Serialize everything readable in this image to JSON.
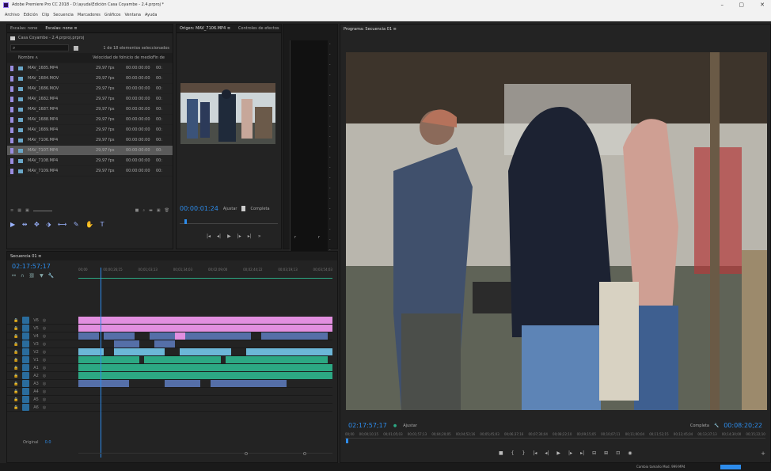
{
  "app": {
    "title": "Adobe Premiere Pro CC 2018 - D:\\ayuda\\Edición Casa Coyambe - 2.4.prproj *",
    "menu": [
      "Archivo",
      "Edición",
      "Clip",
      "Secuencia",
      "Marcadores",
      "Gráficos",
      "Ventana",
      "Ayuda"
    ],
    "controls": [
      "–",
      "▢",
      "✕"
    ]
  },
  "project": {
    "tabs": [
      "Escalas: none",
      "Escalas: none ≡"
    ],
    "name": "Casa Coyambe - 2.4.prproj.prproj",
    "search_placeholder": "",
    "count": "1 de 18 elementos seleccionados",
    "columns": [
      "Nombre ∧",
      "Velocidad de fotogr",
      "Inicio de medios",
      "Fin de"
    ],
    "clips": [
      {
        "name": "MAV_1685.MP4",
        "fps": "29,97 fps",
        "start": "00:00:00:00",
        "end": "00:"
      },
      {
        "name": "MAV_1684.MOV",
        "fps": "29,97 fps",
        "start": "00:00:00:00",
        "end": "00:"
      },
      {
        "name": "MAV_1686.MOV",
        "fps": "29,97 fps",
        "start": "00:00:00:00",
        "end": "00:"
      },
      {
        "name": "MAV_1682.MP4",
        "fps": "29,97 fps",
        "start": "00:00:00:00",
        "end": "00:"
      },
      {
        "name": "MAV_1687.MP4",
        "fps": "29,97 fps",
        "start": "00:00:00:00",
        "end": "00:"
      },
      {
        "name": "MAV_1688.MP4",
        "fps": "29,97 fps",
        "start": "00:00:00:00",
        "end": "00:"
      },
      {
        "name": "MAV_1689.MP4",
        "fps": "29,97 fps",
        "start": "00:00:00:00",
        "end": "00:"
      },
      {
        "name": "MAV_7106.MP4",
        "fps": "29,97 fps",
        "start": "00:00:00:00",
        "end": "00:"
      },
      {
        "name": "MAV_7107.MP4",
        "fps": "29,97 fps",
        "start": "00:00:00:00",
        "end": "00:"
      },
      {
        "name": "MAV_7108.MP4",
        "fps": "29,97 fps",
        "start": "00:00:00:00",
        "end": "00:"
      },
      {
        "name": "MAV_7109.MP4",
        "fps": "29,97 fps",
        "start": "00:00:00:00",
        "end": "00:"
      }
    ],
    "selected_index": 8,
    "tools": "▶ ⇹ ✥ ⬗ ⟷ ✎ ✋ T"
  },
  "source": {
    "tabs": [
      "Origen: MAV_7106.MP4 ≡",
      "Controles de efectos",
      "»"
    ],
    "timecode": "00:00:01:24",
    "fit": "Ajustar",
    "quality": "Completa",
    "controls": [
      "|◂",
      "◂|",
      "▶",
      "|▸",
      "▸|",
      "»"
    ]
  },
  "meter": {
    "labels": [
      "-",
      "-",
      "-",
      "-",
      "-",
      "-",
      "-",
      "-",
      "-",
      "-",
      "-",
      "-",
      "-",
      "-",
      "-",
      "-",
      "-",
      "-",
      "-",
      "-",
      "-",
      "-",
      "-"
    ],
    "bottom": [
      "r",
      "r"
    ]
  },
  "program": {
    "tab": "Programa: Secuencia 01 ≡",
    "timecode": "02:17:57;17",
    "fit": "Ajustar",
    "quality": "Completa",
    "duration": "00:08:20;22",
    "ruler": [
      "00;00",
      "00;00;10;15",
      "00;01;05;03",
      "00;01;57;13",
      "00;04;20;05",
      "00;04;52;16",
      "00;05;45;03",
      "00;06;37;16",
      "00;07;30;04",
      "00;08;22;10",
      "00;09;15;05",
      "00;10;07;11",
      "00;11;00;04",
      "00;11;52;15",
      "00;12;45;04",
      "00;13;37;13",
      "00;14;30;00",
      "00;15;22;10"
    ],
    "controls": [
      "■",
      "{",
      "}",
      "|◂",
      "◂|",
      "▶",
      "|▸",
      "▸|",
      "⊟",
      "⊞",
      "⊡",
      "◉"
    ],
    "status": "Cambio tamaño Mod. 999 MP4"
  },
  "timeline": {
    "tab": "Secuencia 01 ≡",
    "timecode": "02:17:57;17",
    "ruler": [
      "00;00",
      "00;00;26;15",
      "00;01;03;13",
      "00;01;34;03",
      "00;02;09;00",
      "00;02;44;22",
      "00;03;19;13",
      "00;03;54;03"
    ],
    "tracks": [
      {
        "name": "V6"
      },
      {
        "name": "V5"
      },
      {
        "name": "V4"
      },
      {
        "name": "V3"
      },
      {
        "name": "V2"
      },
      {
        "name": "V1"
      },
      {
        "name": "A1"
      },
      {
        "name": "A2"
      },
      {
        "name": "A3"
      },
      {
        "name": "A4"
      },
      {
        "name": "A5"
      },
      {
        "name": "A6"
      }
    ],
    "original_label": "Original",
    "original_val": "0.0",
    "scroll_marks": [
      "O",
      "O"
    ]
  },
  "colors": {
    "accent": "#2d8ceb",
    "pink": "#e28fe0",
    "video": "#6cb7d8",
    "audio": "#2ca883"
  }
}
